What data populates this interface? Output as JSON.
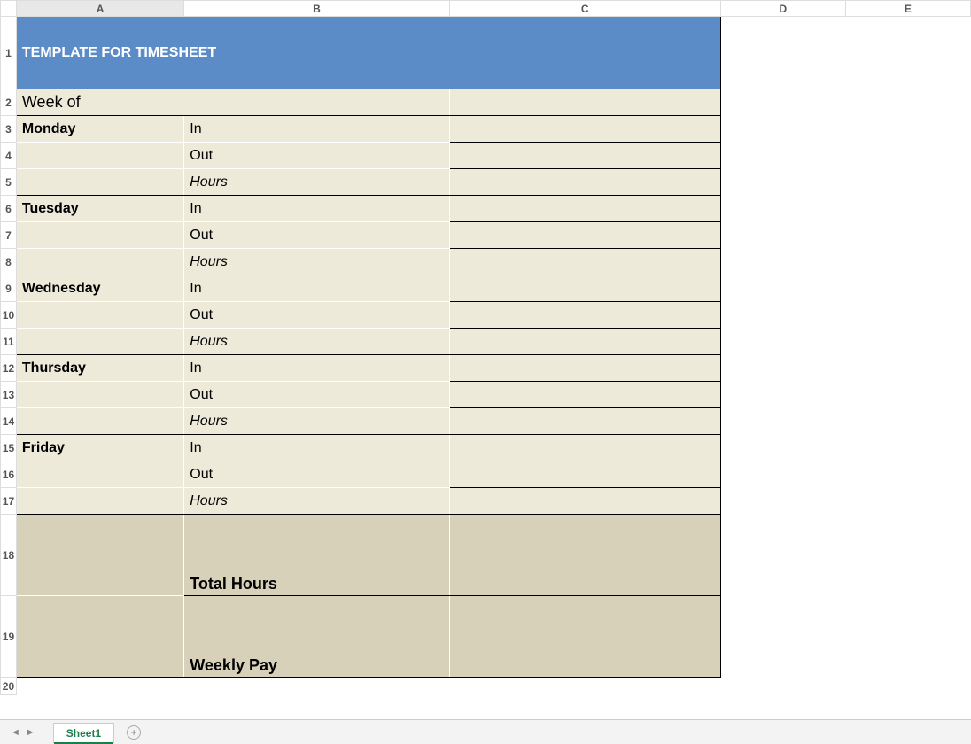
{
  "columns": [
    "A",
    "B",
    "C",
    "D",
    "E"
  ],
  "title": "TEMPLATE FOR TIMESHEET",
  "week_of_label": "Week of",
  "days": {
    "mon": {
      "name": "Monday",
      "in": "In",
      "out": "Out",
      "hours": "Hours"
    },
    "tue": {
      "name": "Tuesday",
      "in": "In",
      "out": "Out",
      "hours": "Hours"
    },
    "wed": {
      "name": "Wednesday",
      "in": "In",
      "out": "Out",
      "hours": "Hours"
    },
    "thu": {
      "name": "Thursday",
      "in": "In",
      "out": "Out",
      "hours": "Hours"
    },
    "fri": {
      "name": "Friday",
      "in": "In",
      "out": "Out",
      "hours": "Hours"
    }
  },
  "totals": {
    "total_hours_label": "Total Hours",
    "weekly_pay_label": "Weekly Pay"
  },
  "tabs": {
    "sheet1": "Sheet1"
  },
  "rows": [
    "1",
    "2",
    "3",
    "4",
    "5",
    "6",
    "7",
    "8",
    "9",
    "10",
    "11",
    "12",
    "13",
    "14",
    "15",
    "16",
    "17",
    "18",
    "19",
    "20"
  ]
}
